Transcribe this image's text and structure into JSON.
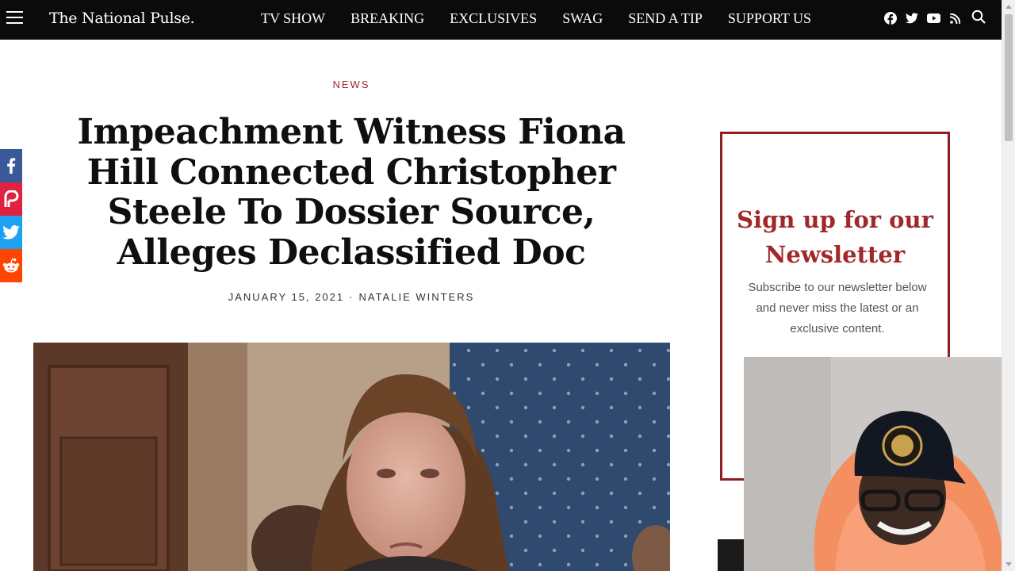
{
  "site": {
    "logo": "The National Pulse."
  },
  "nav": {
    "items": [
      "TV SHOW",
      "BREAKING",
      "EXCLUSIVES",
      "SWAG",
      "SEND A TIP",
      "SUPPORT US"
    ]
  },
  "article": {
    "category": "NEWS",
    "headline": "Impeachment Witness Fiona Hill Connected Christopher Steele To Dossier Source, Alleges Declassified Doc",
    "date": "JANUARY 15, 2021",
    "separator": "·",
    "author": "NATALIE WINTERS"
  },
  "newsletter": {
    "title": "Sign up for our Newsletter",
    "body": "Subscribe to our newsletter below and never miss the latest or an exclusive content."
  },
  "share": [
    "facebook-icon",
    "parler-icon",
    "twitter-icon",
    "reddit-icon"
  ],
  "social": [
    "facebook-icon",
    "twitter-icon",
    "youtube-icon",
    "rss-icon"
  ],
  "colors": {
    "accent": "#a0282a",
    "navbar": "#0b0b0b",
    "facebook": "#3b5998",
    "twitter": "#1da1f2",
    "reddit": "#ff4500",
    "parler": "#e0213f"
  }
}
